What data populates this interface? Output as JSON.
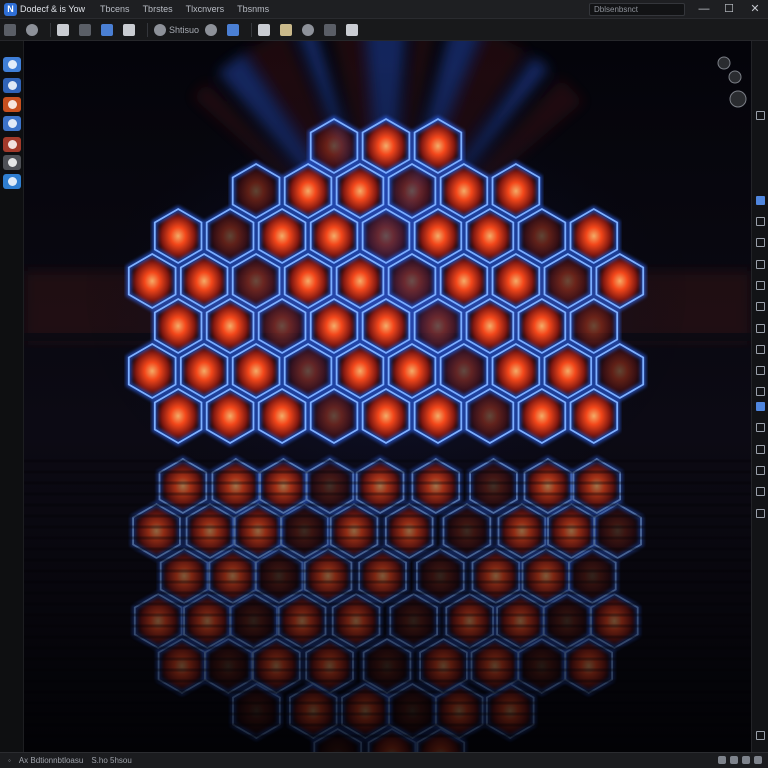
{
  "app": {
    "logo_glyph": "N",
    "title": "Dodecf & is Yow"
  },
  "menu": [
    {
      "label": "Tbcens"
    },
    {
      "label": "Tbrstes"
    },
    {
      "label": "Tlxcnvers"
    },
    {
      "label": "Tbsnms"
    }
  ],
  "title_search": {
    "value": "Dblsenbsnct"
  },
  "window_controls": {
    "minimize": "—",
    "maximize": "☐",
    "close": "✕"
  },
  "toolbar": {
    "items": [
      {
        "icon": "new-file-icon",
        "label": ""
      },
      {
        "icon": "open-icon",
        "label": ""
      },
      {
        "icon": "save-icon",
        "label": ""
      },
      {
        "icon": "brush-icon",
        "label": ""
      },
      {
        "icon": "transform-icon",
        "label": ""
      },
      {
        "icon": "layers-icon",
        "label": ""
      },
      {
        "icon": "material-icon",
        "label": "Shtisuo"
      },
      {
        "icon": "render-icon",
        "label": ""
      },
      {
        "icon": "lighting-icon",
        "label": ""
      },
      {
        "icon": "document-icon",
        "label": ""
      },
      {
        "icon": "folder-icon",
        "label": ""
      },
      {
        "icon": "undo-icon",
        "label": ""
      },
      {
        "icon": "cloud-icon",
        "label": ""
      },
      {
        "icon": "filter-icon",
        "label": ""
      }
    ]
  },
  "left_tools": [
    {
      "icon": "sphere-tool-icon",
      "color": "#3f7fd8"
    },
    {
      "icon": "globe-tool-icon",
      "color": "#2f63b8"
    },
    {
      "icon": "fire-tool-icon",
      "color": "#c8501e"
    },
    {
      "icon": "link-tool-icon",
      "color": "#3c73c9"
    },
    {
      "icon": "cube-tool-icon",
      "color": "#a33a2a"
    },
    {
      "icon": "mesh-tool-icon",
      "color": "#4e5056"
    },
    {
      "icon": "orbit-tool-icon",
      "color": "#2f7ed0"
    }
  ],
  "statusbar": {
    "left_a": "",
    "left_b": "Ax Bdtionnbtloasu",
    "left_c": "S.ho 5hsou"
  },
  "colors": {
    "accent": "#4a7fd4",
    "neon_blue": "#2f6bff",
    "ember": "#ff4a1a"
  }
}
